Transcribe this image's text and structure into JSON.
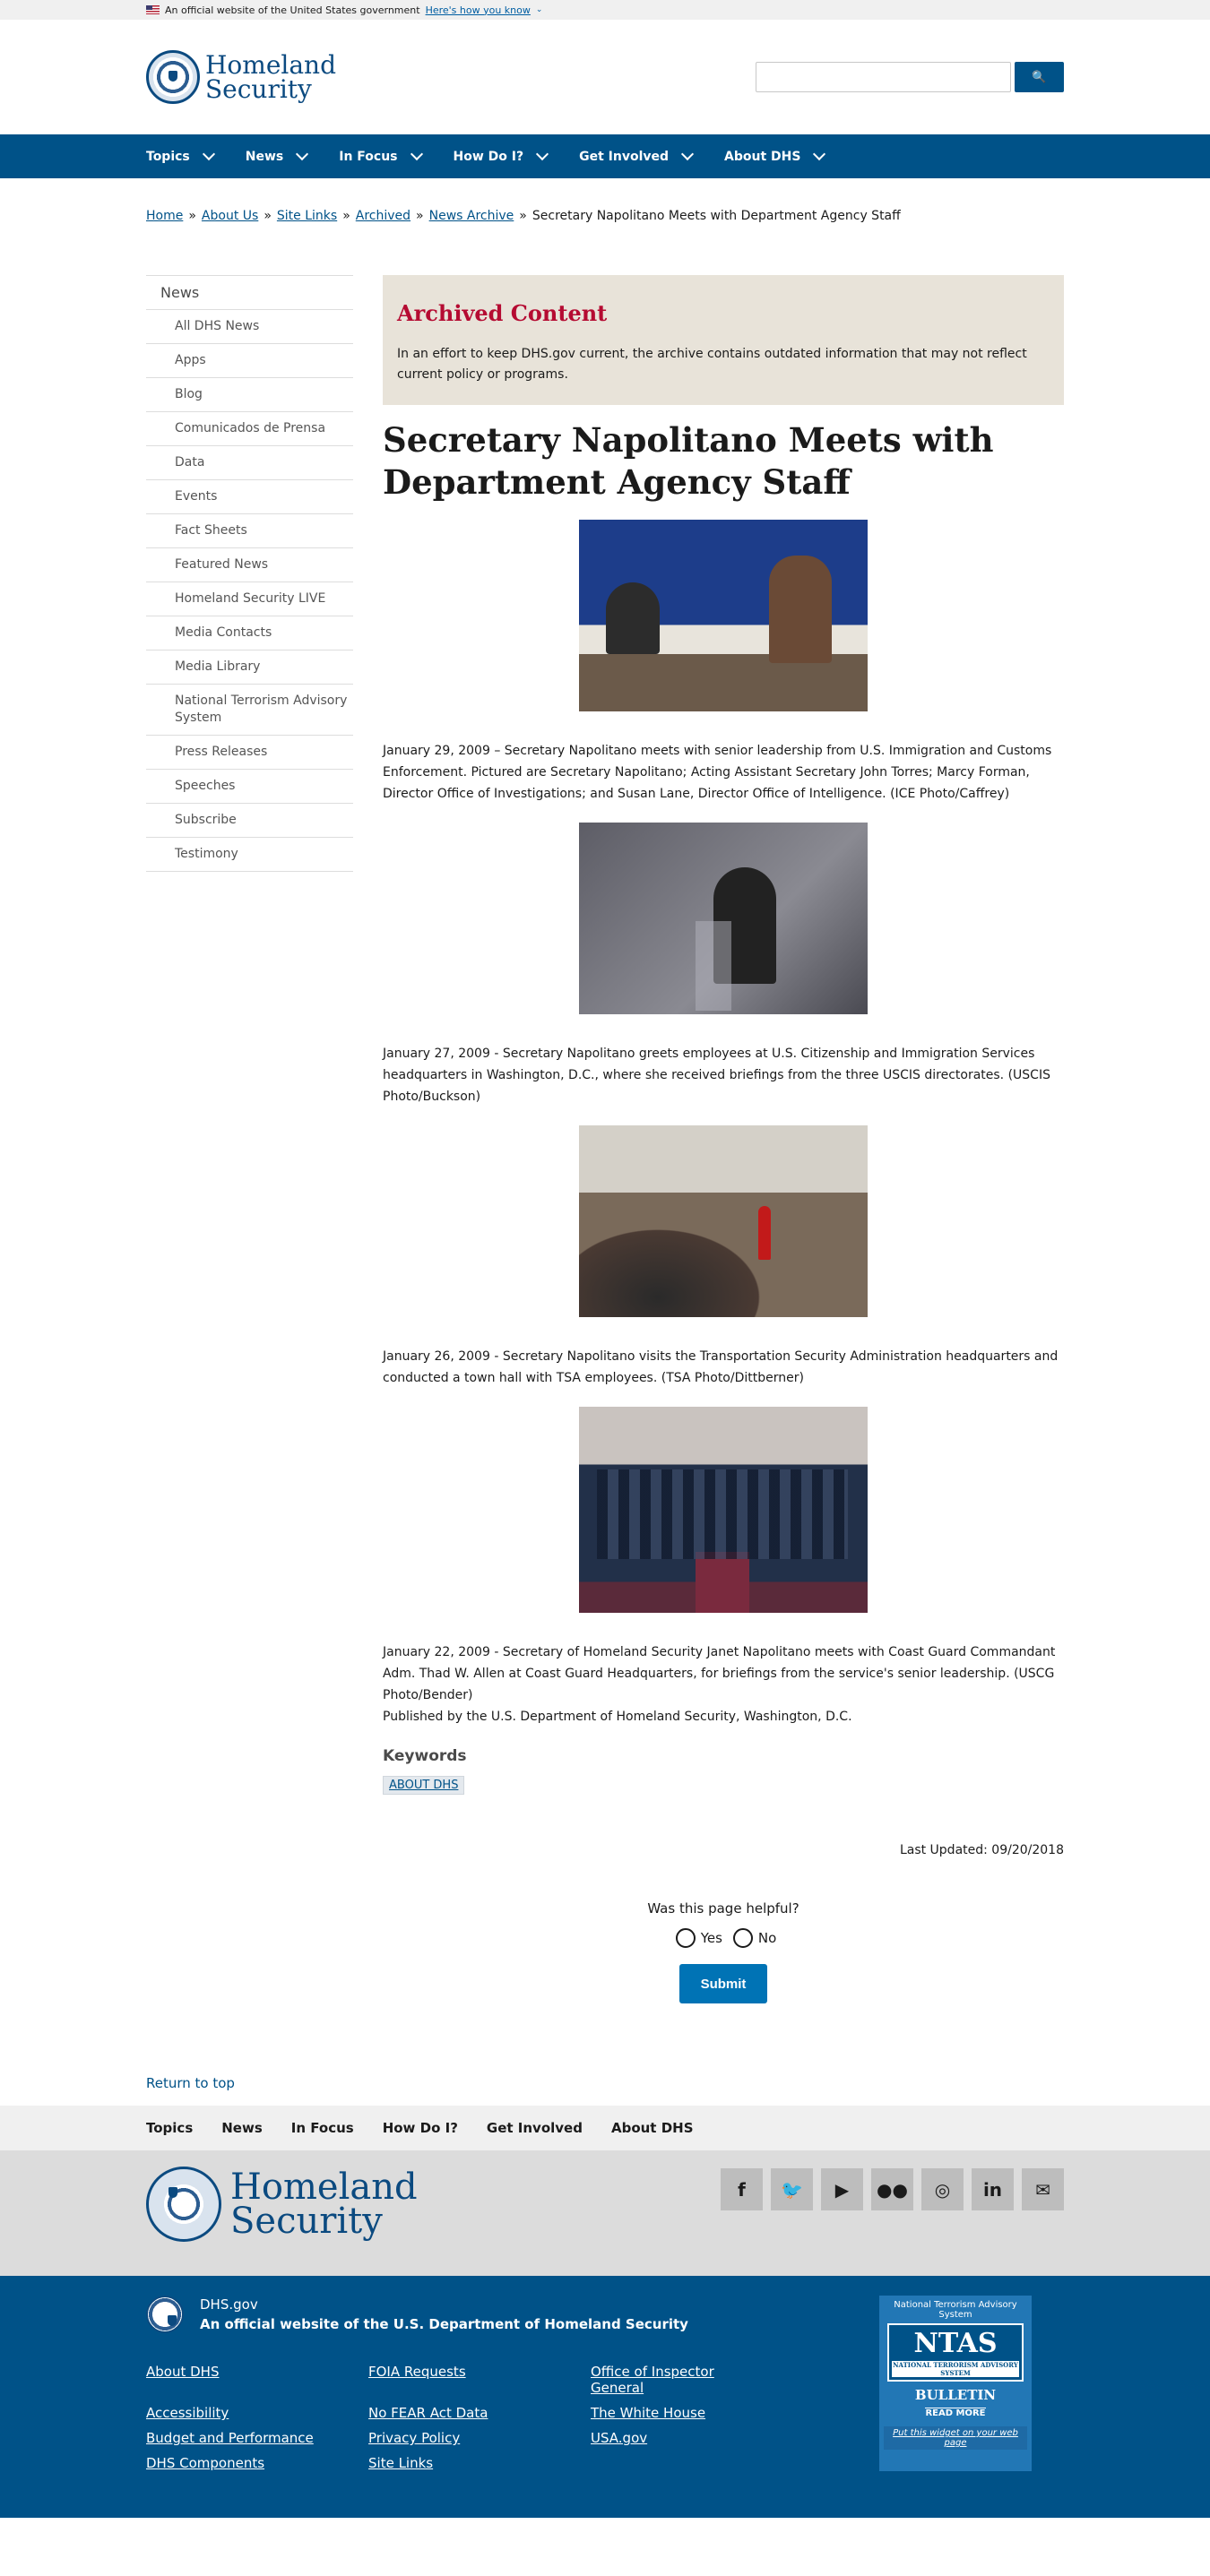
{
  "gov_banner": {
    "text": "An official website of the United States government",
    "link": "Here's how you know"
  },
  "header": {
    "logo_line1": "Homeland",
    "logo_line2": "Security",
    "search_placeholder": "",
    "search_button": "🔍"
  },
  "main_nav": [
    "Topics",
    "News",
    "In Focus",
    "How Do I?",
    "Get Involved",
    "About DHS"
  ],
  "breadcrumb": {
    "items": [
      "Home",
      "About Us",
      "Site Links",
      "Archived",
      "News Archive"
    ],
    "current": "Secretary Napolitano Meets with Department Agency Staff"
  },
  "sidebar": {
    "heading": "News",
    "items": [
      "All DHS News",
      "Apps",
      "Blog",
      "Comunicados de Prensa",
      "Data",
      "Events",
      "Fact Sheets",
      "Featured News",
      "Homeland Security LIVE",
      "Media Contacts",
      "Media Library",
      "National Terrorism Advisory System",
      "Press Releases",
      "Speeches",
      "Subscribe",
      "Testimony"
    ]
  },
  "archived": {
    "title": "Archived Content",
    "text": "In an effort to keep DHS.gov current, the archive contains outdated information that may not reflect current policy or programs."
  },
  "article": {
    "title": "Secretary Napolitano Meets with Department Agency Staff",
    "captions": [
      "January 29, 2009 – Secretary Napolitano meets with senior leadership from U.S. Immigration and Customs Enforcement. Pictured are Secretary Napolitano; Acting Assistant Secretary John Torres; Marcy Forman, Director Office of Investigations; and Susan Lane, Director Office of Intelligence. (ICE Photo/Caffrey)",
      "January 27, 2009 - Secretary Napolitano greets employees at U.S. Citizenship and Immigration Services headquarters in Washington, D.C., where she received briefings from the three USCIS directorates. (USCIS Photo/Buckson)",
      "January 26, 2009 - Secretary Napolitano visits the Transportation Security Administration headquarters and conducted a town hall with TSA employees. (TSA Photo/Dittberner)",
      "January 22, 2009 - Secretary of Homeland Security Janet Napolitano meets with Coast Guard Commandant Adm. Thad W. Allen at Coast Guard Headquarters, for briefings from the service's senior leadership. (USCG Photo/Bender)"
    ],
    "published": "Published by the U.S. Department of Homeland Security, Washington, D.C.",
    "keywords_title": "Keywords",
    "keyword": "ABOUT DHS",
    "last_updated": "Last Updated: 09/20/2018"
  },
  "feedback": {
    "question": "Was this page helpful?",
    "yes": "Yes",
    "no": "No",
    "submit": "Submit"
  },
  "return_top": "Return to top",
  "footer_nav": [
    "Topics",
    "News",
    "In Focus",
    "How Do I?",
    "Get Involved",
    "About DHS"
  ],
  "footer_logo": {
    "line1": "Homeland",
    "line2": "Security"
  },
  "social_icons": [
    "facebook-icon",
    "twitter-icon",
    "youtube-icon",
    "flickr-icon",
    "instagram-icon",
    "linkedin-icon",
    "email-icon"
  ],
  "social_glyphs": [
    "f",
    "🐦",
    "▶",
    "●●",
    "◎",
    "in",
    "✉"
  ],
  "footer_bottom": {
    "site": "DHS.gov",
    "official_prefix": "An official website of the",
    "official_link": "U.S. Department of Homeland Security",
    "links": [
      "About DHS",
      "FOIA Requests",
      "Office of Inspector General",
      "Accessibility",
      "No FEAR Act Data",
      "The White House",
      "Budget and Performance",
      "Privacy Policy",
      "USA.gov",
      "DHS Components",
      "Site Links"
    ]
  },
  "ntas": {
    "head": "National Terrorism Advisory System",
    "logo": "NTAS",
    "sub": "NATIONAL TERRORISM ADVISORY SYSTEM",
    "bulletin": "BULLETIN",
    "readmore": "READ MORE",
    "widget": "Put this widget on your web page"
  }
}
